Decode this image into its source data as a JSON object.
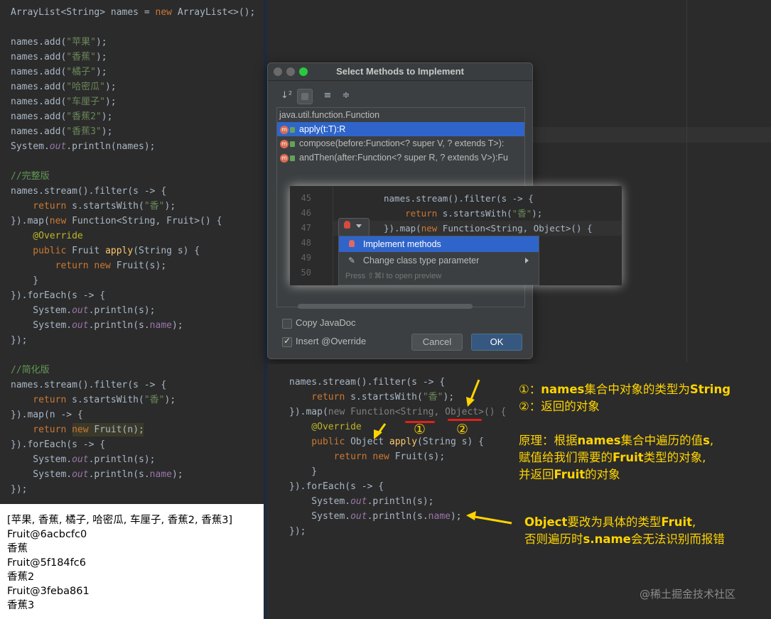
{
  "left_editor": {
    "lines": [
      [
        {
          "t": "ArrayList<String> names = ",
          "c": "tx"
        },
        {
          "t": "new ",
          "c": "kw"
        },
        {
          "t": "ArrayList<>();",
          "c": "tx"
        }
      ],
      [],
      [
        {
          "t": "names.add(",
          "c": "tx"
        },
        {
          "t": "\"苹果\"",
          "c": "str"
        },
        {
          "t": ");",
          "c": "tx"
        }
      ],
      [
        {
          "t": "names.add(",
          "c": "tx"
        },
        {
          "t": "\"香蕉\"",
          "c": "str"
        },
        {
          "t": ");",
          "c": "tx"
        }
      ],
      [
        {
          "t": "names.add(",
          "c": "tx"
        },
        {
          "t": "\"橘子\"",
          "c": "str"
        },
        {
          "t": ");",
          "c": "tx"
        }
      ],
      [
        {
          "t": "names.add(",
          "c": "tx"
        },
        {
          "t": "\"哈密瓜\"",
          "c": "str"
        },
        {
          "t": ");",
          "c": "tx"
        }
      ],
      [
        {
          "t": "names.add(",
          "c": "tx"
        },
        {
          "t": "\"车厘子\"",
          "c": "str"
        },
        {
          "t": ");",
          "c": "tx"
        }
      ],
      [
        {
          "t": "names.add(",
          "c": "tx"
        },
        {
          "t": "\"香蕉2\"",
          "c": "str"
        },
        {
          "t": ");",
          "c": "tx"
        }
      ],
      [
        {
          "t": "names.add(",
          "c": "tx"
        },
        {
          "t": "\"香蕉3\"",
          "c": "str"
        },
        {
          "t": ");",
          "c": "tx"
        }
      ],
      [
        {
          "t": "System.",
          "c": "tx"
        },
        {
          "t": "out",
          "c": "fld"
        },
        {
          "t": ".println(names);",
          "c": "tx"
        }
      ],
      [],
      [
        {
          "t": "//完整版",
          "c": "cm"
        }
      ],
      [
        {
          "t": "names.stream().filter(s -> {",
          "c": "tx"
        }
      ],
      [
        {
          "t": "    return ",
          "c": "kw"
        },
        {
          "t": "s.startsWith(",
          "c": "tx"
        },
        {
          "t": "\"香\"",
          "c": "str"
        },
        {
          "t": ");",
          "c": "tx"
        }
      ],
      [
        {
          "t": "}).map(",
          "c": "tx"
        },
        {
          "t": "new ",
          "c": "kw"
        },
        {
          "t": "Function<String, Fruit>() {",
          "c": "tx"
        }
      ],
      [
        {
          "t": "    @Override",
          "c": "ann"
        }
      ],
      [
        {
          "t": "    public ",
          "c": "kw"
        },
        {
          "t": "Fruit ",
          "c": "tx"
        },
        {
          "t": "apply",
          "c": "fn"
        },
        {
          "t": "(String s) {",
          "c": "tx"
        }
      ],
      [
        {
          "t": "        return new ",
          "c": "kw"
        },
        {
          "t": "Fruit(s);",
          "c": "tx"
        }
      ],
      [
        {
          "t": "    }",
          "c": "tx"
        }
      ],
      [
        {
          "t": "}).forEach(s -> {",
          "c": "tx"
        }
      ],
      [
        {
          "t": "    System.",
          "c": "tx"
        },
        {
          "t": "out",
          "c": "fld"
        },
        {
          "t": ".println(s);",
          "c": "tx"
        }
      ],
      [
        {
          "t": "    System.",
          "c": "tx"
        },
        {
          "t": "out",
          "c": "fld"
        },
        {
          "t": ".println(s.",
          "c": "tx"
        },
        {
          "t": "name",
          "c": "fld2"
        },
        {
          "t": ");",
          "c": "tx"
        }
      ],
      [
        {
          "t": "});",
          "c": "tx"
        }
      ],
      [],
      [
        {
          "t": "//简化版",
          "c": "cm"
        }
      ],
      [
        {
          "t": "names.stream().filter(s -> {",
          "c": "tx"
        }
      ],
      [
        {
          "t": "    return ",
          "c": "kw"
        },
        {
          "t": "s.startsWith(",
          "c": "tx"
        },
        {
          "t": "\"香\"",
          "c": "str"
        },
        {
          "t": ");",
          "c": "tx"
        }
      ],
      [
        {
          "t": "}).map(n -> {",
          "c": "tx"
        }
      ],
      [
        {
          "t": "    return ",
          "c": "kw"
        },
        {
          "t": "new ",
          "c": "kw"
        },
        {
          "t": "Fruit(n);",
          "c": "tx"
        }
      ],
      [
        {
          "t": "}).forEach(s -> {",
          "c": "tx"
        }
      ],
      [
        {
          "t": "    System.",
          "c": "tx"
        },
        {
          "t": "out",
          "c": "fld"
        },
        {
          "t": ".println(s);",
          "c": "tx"
        }
      ],
      [
        {
          "t": "    System.",
          "c": "tx"
        },
        {
          "t": "out",
          "c": "fld"
        },
        {
          "t": ".println(s.",
          "c": "tx"
        },
        {
          "t": "name",
          "c": "fld2"
        },
        {
          "t": ");",
          "c": "tx"
        }
      ],
      [
        {
          "t": "});",
          "c": "tx"
        }
      ]
    ]
  },
  "console_output": [
    "[苹果, 香蕉, 橘子, 哈密瓜, 车厘子, 香蕉2, 香蕉3]",
    "Fruit@6acbcfc0",
    "香蕉",
    "Fruit@5f184fc6",
    "香蕉2",
    "Fruit@3feba861",
    "香蕉3"
  ],
  "dialog": {
    "title": "Select Methods to Implement",
    "toolbar": {
      "sort": "↓²",
      "expand": "≡",
      "collapse": "≑"
    },
    "tree": {
      "group": "java.util.function.Function",
      "methods": [
        {
          "label": "apply(t:T):R",
          "selected": true
        },
        {
          "label": "compose(before:Function<? super V, ? extends T>):",
          "selected": false
        },
        {
          "label": "andThen(after:Function<? super R, ? extends V>):Fu",
          "selected": false
        }
      ]
    },
    "copy_javadoc": {
      "label": "Copy JavaDoc",
      "checked": false
    },
    "insert_override": {
      "label": "Insert @Override",
      "checked": true
    },
    "cancel_label": "Cancel",
    "ok_label": "OK"
  },
  "snippet": {
    "line_numbers": [
      "45",
      "46",
      "47",
      "48",
      "49",
      "50"
    ],
    "lines": [
      [
        {
          "t": "names.stream().filter(s -> {",
          "c": "tx"
        }
      ],
      [
        {
          "t": "    return ",
          "c": "kw"
        },
        {
          "t": "s.startsWith(",
          "c": "tx"
        },
        {
          "t": "\"香\"",
          "c": "str"
        },
        {
          "t": ");",
          "c": "tx"
        }
      ],
      [
        {
          "t": "}).map(",
          "c": "tx"
        },
        {
          "t": "new ",
          "c": "kw"
        },
        {
          "t": "Function<String, Object>() {",
          "c": "tx"
        }
      ]
    ],
    "intent_menu": {
      "items": [
        {
          "label": "Implement methods",
          "selected": true
        },
        {
          "label": "Change class type parameter",
          "selected": false
        }
      ],
      "hint": "Press ⇧⌘I to open preview"
    }
  },
  "annotated": {
    "lines": [
      [
        {
          "t": "names.stream().filter(s -> {",
          "c": "tx"
        }
      ],
      [
        {
          "t": "    return ",
          "c": "kw"
        },
        {
          "t": "s.startsWith(",
          "c": "tx"
        },
        {
          "t": "\"香\"",
          "c": "str"
        },
        {
          "t": ");",
          "c": "tx"
        }
      ],
      [
        {
          "t": "}).map(",
          "c": "tx"
        },
        {
          "t": "new ",
          "c": "gry"
        },
        {
          "t": "Function<String, ",
          "c": "gry"
        },
        {
          "t": "Object",
          "c": "gry"
        },
        {
          "t": ">() {",
          "c": "gry"
        }
      ],
      [
        {
          "t": "    @Override",
          "c": "ann"
        }
      ],
      [
        {
          "t": "    public ",
          "c": "kw"
        },
        {
          "t": "Object ",
          "c": "tx"
        },
        {
          "t": "apply",
          "c": "fn"
        },
        {
          "t": "(String s) {",
          "c": "tx"
        }
      ],
      [
        {
          "t": "        return new ",
          "c": "kw"
        },
        {
          "t": "Fruit(s);",
          "c": "tx"
        }
      ],
      [
        {
          "t": "    }",
          "c": "tx"
        }
      ],
      [
        {
          "t": "}).forEach(s -> {",
          "c": "tx"
        }
      ],
      [
        {
          "t": "    System.",
          "c": "tx"
        },
        {
          "t": "out",
          "c": "fld"
        },
        {
          "t": ".println(s);",
          "c": "tx"
        }
      ],
      [
        {
          "t": "    System.",
          "c": "tx"
        },
        {
          "t": "out",
          "c": "fld"
        },
        {
          "t": ".println(s.",
          "c": "tx"
        },
        {
          "t": "name",
          "c": "fld2"
        },
        {
          "t": ");",
          "c": "tx"
        }
      ],
      [
        {
          "t": "});",
          "c": "tx"
        }
      ]
    ],
    "markers": [
      "①",
      "②"
    ],
    "notes": {
      "n1_prefix": "①：",
      "n1_bold1": "names",
      "n1_mid": "集合中对象的类型为",
      "n1_bold2": "String",
      "n2_prefix": "②：",
      "n2_text": "返回的对象",
      "p1_prefix": "原理：根据",
      "p1_bold": "names",
      "p1_mid": "集合中遍历的值",
      "p1_bold2": "s",
      "p1_end": ",",
      "p2_prefix": "赋值给我们需要的",
      "p2_bold": "Fruit",
      "p2_end": "类型的对象,",
      "p3_prefix": "并返回",
      "p3_bold": "Fruit",
      "p3_end": "的对象",
      "o1_bold": "Object",
      "o1_mid": "要改为具体的类型",
      "o1_bold2": "Fruit",
      "o1_end": ",",
      "o2_prefix": "否则遍历时",
      "o2_bold": "s.name",
      "o2_end": "会无法识别而报错"
    }
  },
  "watermark": "@稀土掘金技术社区",
  "colors": {
    "accent_yellow": "#ffd400",
    "selection_blue": "#2f65ca",
    "underline_red": "#e0211c"
  }
}
